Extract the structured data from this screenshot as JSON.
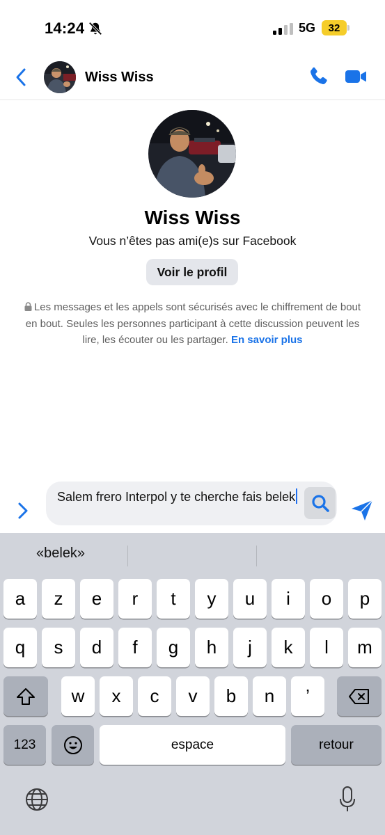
{
  "status_bar": {
    "time": "14:24",
    "network": "5G",
    "battery": "32"
  },
  "header": {
    "contact_name": "Wiss Wiss"
  },
  "profile": {
    "name": "Wiss Wiss",
    "friend_status": "Vous n’êtes pas ami(e)s sur Facebook",
    "view_profile_label": "Voir le profil"
  },
  "encryption_notice": {
    "text": "Les messages et les appels sont sécurisés avec le chiffrement de bout en bout. Seules les personnes participant à cette discussion peuvent les lire, les écouter ou les partager.",
    "link": "En savoir plus"
  },
  "composer": {
    "value": "Salem frero Interpol y te cherche fais belek"
  },
  "keyboard": {
    "suggestions": [
      "«belek»",
      "",
      ""
    ],
    "row1": [
      "a",
      "z",
      "e",
      "r",
      "t",
      "y",
      "u",
      "i",
      "o",
      "p"
    ],
    "row2": [
      "q",
      "s",
      "d",
      "f",
      "g",
      "h",
      "j",
      "k",
      "l",
      "m"
    ],
    "row3": [
      "w",
      "x",
      "c",
      "v",
      "b",
      "n",
      "’"
    ],
    "numbers_label": "123",
    "space_label": "espace",
    "return_label": "retour"
  },
  "colors": {
    "accent": "#1a73e8",
    "battery": "#f5cd2a",
    "keyboard_bg": "#d1d4db"
  }
}
